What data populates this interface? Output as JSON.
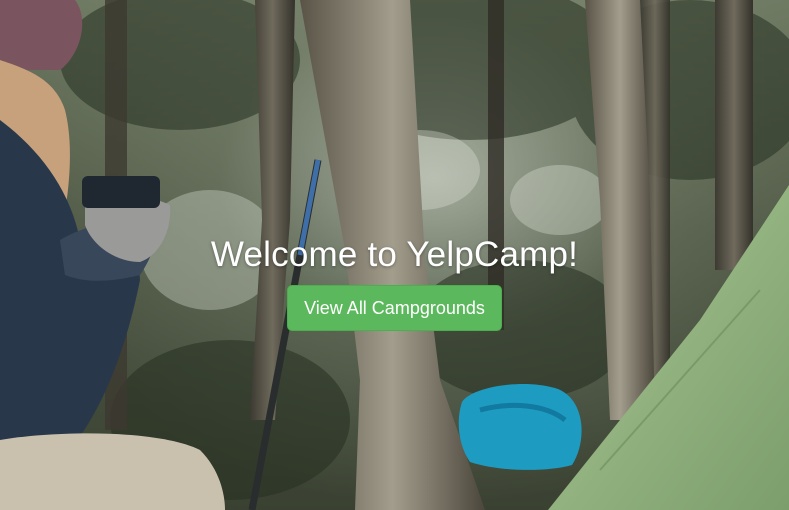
{
  "hero": {
    "title": "Welcome to YelpCamp!",
    "button_label": "View All Campgrounds",
    "accent_color": "#5cb85c"
  }
}
